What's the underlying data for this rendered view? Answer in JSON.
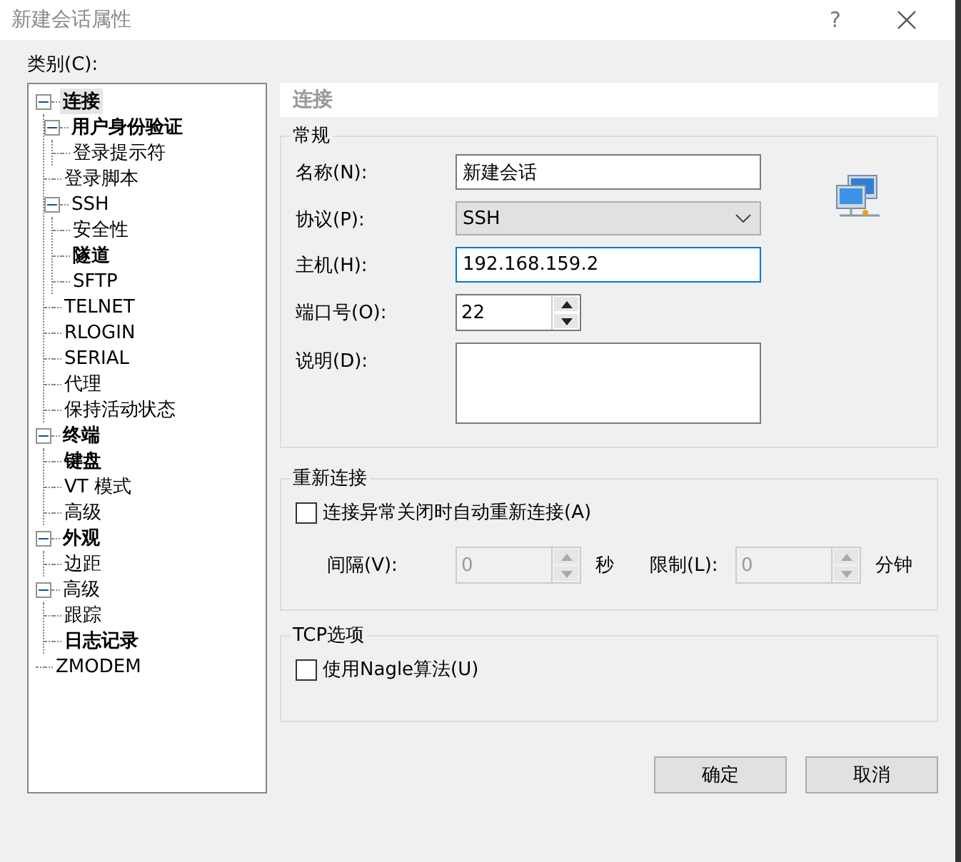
{
  "window": {
    "title": "新建会话属性",
    "help": "?"
  },
  "category_label": "类别(C):",
  "tree": [
    {
      "label": "连接",
      "bold": true,
      "selected": true,
      "expanded": true,
      "children": [
        {
          "label": "用户身份验证",
          "bold": true,
          "selected": false,
          "expanded": true,
          "children": [
            {
              "label": "登录提示符",
              "bold": false,
              "selected": false
            }
          ]
        },
        {
          "label": "登录脚本",
          "bold": false,
          "selected": false
        },
        {
          "label": "SSH",
          "bold": false,
          "selected": false,
          "expanded": true,
          "children": [
            {
              "label": "安全性",
              "bold": false,
              "selected": false
            },
            {
              "label": "隧道",
              "bold": true,
              "selected": false
            },
            {
              "label": "SFTP",
              "bold": false,
              "selected": false
            }
          ]
        },
        {
          "label": "TELNET",
          "bold": false,
          "selected": false
        },
        {
          "label": "RLOGIN",
          "bold": false,
          "selected": false
        },
        {
          "label": "SERIAL",
          "bold": false,
          "selected": false
        },
        {
          "label": "代理",
          "bold": false,
          "selected": false
        },
        {
          "label": "保持活动状态",
          "bold": false,
          "selected": false
        }
      ]
    },
    {
      "label": "终端",
      "bold": true,
      "selected": false,
      "expanded": true,
      "children": [
        {
          "label": "键盘",
          "bold": true,
          "selected": false
        },
        {
          "label": "VT 模式",
          "bold": false,
          "selected": false
        },
        {
          "label": "高级",
          "bold": false,
          "selected": false
        }
      ]
    },
    {
      "label": "外观",
      "bold": true,
      "selected": false,
      "expanded": true,
      "children": [
        {
          "label": "边距",
          "bold": false,
          "selected": false
        }
      ]
    },
    {
      "label": "高级",
      "bold": false,
      "selected": false,
      "expanded": true,
      "children": [
        {
          "label": "跟踪",
          "bold": false,
          "selected": false
        },
        {
          "label": "日志记录",
          "bold": true,
          "selected": false
        }
      ]
    },
    {
      "label": "ZMODEM",
      "bold": false,
      "selected": false
    }
  ],
  "panel_title": "连接",
  "general": {
    "title": "常规",
    "fields": [
      {
        "kind": "text",
        "label": "名称(N):",
        "value": "新建会话",
        "focused": false
      },
      {
        "kind": "select",
        "label": "协议(P):",
        "value": "SSH"
      },
      {
        "kind": "text",
        "label": "主机(H):",
        "value": "192.168.159.2",
        "focused": true
      },
      {
        "kind": "spin",
        "label": "端口号(O):",
        "value": "22"
      },
      {
        "kind": "textarea",
        "label": "说明(D):"
      }
    ]
  },
  "reconnect": {
    "title": "重新连接",
    "checkbox": {
      "label": "连接异常关闭时自动重新连接(A)",
      "checked": false
    },
    "interval": {
      "label": "间隔(V):",
      "value": "0",
      "unit": "秒",
      "disabled": true
    },
    "limit": {
      "label": "限制(L):",
      "value": "0",
      "unit": "分钟",
      "disabled": true
    }
  },
  "tcp": {
    "title": "TCP选项",
    "checkbox": {
      "label": "使用Nagle算法(U)",
      "checked": false
    }
  },
  "buttons": [
    "确定",
    "取消"
  ]
}
